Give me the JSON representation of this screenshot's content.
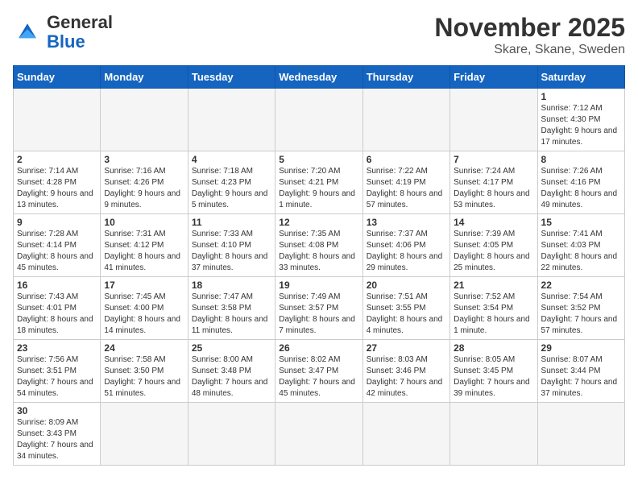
{
  "header": {
    "logo_text_regular": "General",
    "logo_text_blue": "Blue",
    "month_title": "November 2025",
    "location": "Skare, Skane, Sweden"
  },
  "days_of_week": [
    "Sunday",
    "Monday",
    "Tuesday",
    "Wednesday",
    "Thursday",
    "Friday",
    "Saturday"
  ],
  "weeks": [
    [
      {
        "day": "",
        "info": ""
      },
      {
        "day": "",
        "info": ""
      },
      {
        "day": "",
        "info": ""
      },
      {
        "day": "",
        "info": ""
      },
      {
        "day": "",
        "info": ""
      },
      {
        "day": "",
        "info": ""
      },
      {
        "day": "1",
        "info": "Sunrise: 7:12 AM\nSunset: 4:30 PM\nDaylight: 9 hours and 17 minutes."
      }
    ],
    [
      {
        "day": "2",
        "info": "Sunrise: 7:14 AM\nSunset: 4:28 PM\nDaylight: 9 hours and 13 minutes."
      },
      {
        "day": "3",
        "info": "Sunrise: 7:16 AM\nSunset: 4:26 PM\nDaylight: 9 hours and 9 minutes."
      },
      {
        "day": "4",
        "info": "Sunrise: 7:18 AM\nSunset: 4:23 PM\nDaylight: 9 hours and 5 minutes."
      },
      {
        "day": "5",
        "info": "Sunrise: 7:20 AM\nSunset: 4:21 PM\nDaylight: 9 hours and 1 minute."
      },
      {
        "day": "6",
        "info": "Sunrise: 7:22 AM\nSunset: 4:19 PM\nDaylight: 8 hours and 57 minutes."
      },
      {
        "day": "7",
        "info": "Sunrise: 7:24 AM\nSunset: 4:17 PM\nDaylight: 8 hours and 53 minutes."
      },
      {
        "day": "8",
        "info": "Sunrise: 7:26 AM\nSunset: 4:16 PM\nDaylight: 8 hours and 49 minutes."
      }
    ],
    [
      {
        "day": "9",
        "info": "Sunrise: 7:28 AM\nSunset: 4:14 PM\nDaylight: 8 hours and 45 minutes."
      },
      {
        "day": "10",
        "info": "Sunrise: 7:31 AM\nSunset: 4:12 PM\nDaylight: 8 hours and 41 minutes."
      },
      {
        "day": "11",
        "info": "Sunrise: 7:33 AM\nSunset: 4:10 PM\nDaylight: 8 hours and 37 minutes."
      },
      {
        "day": "12",
        "info": "Sunrise: 7:35 AM\nSunset: 4:08 PM\nDaylight: 8 hours and 33 minutes."
      },
      {
        "day": "13",
        "info": "Sunrise: 7:37 AM\nSunset: 4:06 PM\nDaylight: 8 hours and 29 minutes."
      },
      {
        "day": "14",
        "info": "Sunrise: 7:39 AM\nSunset: 4:05 PM\nDaylight: 8 hours and 25 minutes."
      },
      {
        "day": "15",
        "info": "Sunrise: 7:41 AM\nSunset: 4:03 PM\nDaylight: 8 hours and 22 minutes."
      }
    ],
    [
      {
        "day": "16",
        "info": "Sunrise: 7:43 AM\nSunset: 4:01 PM\nDaylight: 8 hours and 18 minutes."
      },
      {
        "day": "17",
        "info": "Sunrise: 7:45 AM\nSunset: 4:00 PM\nDaylight: 8 hours and 14 minutes."
      },
      {
        "day": "18",
        "info": "Sunrise: 7:47 AM\nSunset: 3:58 PM\nDaylight: 8 hours and 11 minutes."
      },
      {
        "day": "19",
        "info": "Sunrise: 7:49 AM\nSunset: 3:57 PM\nDaylight: 8 hours and 7 minutes."
      },
      {
        "day": "20",
        "info": "Sunrise: 7:51 AM\nSunset: 3:55 PM\nDaylight: 8 hours and 4 minutes."
      },
      {
        "day": "21",
        "info": "Sunrise: 7:52 AM\nSunset: 3:54 PM\nDaylight: 8 hours and 1 minute."
      },
      {
        "day": "22",
        "info": "Sunrise: 7:54 AM\nSunset: 3:52 PM\nDaylight: 7 hours and 57 minutes."
      }
    ],
    [
      {
        "day": "23",
        "info": "Sunrise: 7:56 AM\nSunset: 3:51 PM\nDaylight: 7 hours and 54 minutes."
      },
      {
        "day": "24",
        "info": "Sunrise: 7:58 AM\nSunset: 3:50 PM\nDaylight: 7 hours and 51 minutes."
      },
      {
        "day": "25",
        "info": "Sunrise: 8:00 AM\nSunset: 3:48 PM\nDaylight: 7 hours and 48 minutes."
      },
      {
        "day": "26",
        "info": "Sunrise: 8:02 AM\nSunset: 3:47 PM\nDaylight: 7 hours and 45 minutes."
      },
      {
        "day": "27",
        "info": "Sunrise: 8:03 AM\nSunset: 3:46 PM\nDaylight: 7 hours and 42 minutes."
      },
      {
        "day": "28",
        "info": "Sunrise: 8:05 AM\nSunset: 3:45 PM\nDaylight: 7 hours and 39 minutes."
      },
      {
        "day": "29",
        "info": "Sunrise: 8:07 AM\nSunset: 3:44 PM\nDaylight: 7 hours and 37 minutes."
      }
    ],
    [
      {
        "day": "30",
        "info": "Sunrise: 8:09 AM\nSunset: 3:43 PM\nDaylight: 7 hours and 34 minutes."
      },
      {
        "day": "",
        "info": ""
      },
      {
        "day": "",
        "info": ""
      },
      {
        "day": "",
        "info": ""
      },
      {
        "day": "",
        "info": ""
      },
      {
        "day": "",
        "info": ""
      },
      {
        "day": "",
        "info": ""
      }
    ]
  ]
}
